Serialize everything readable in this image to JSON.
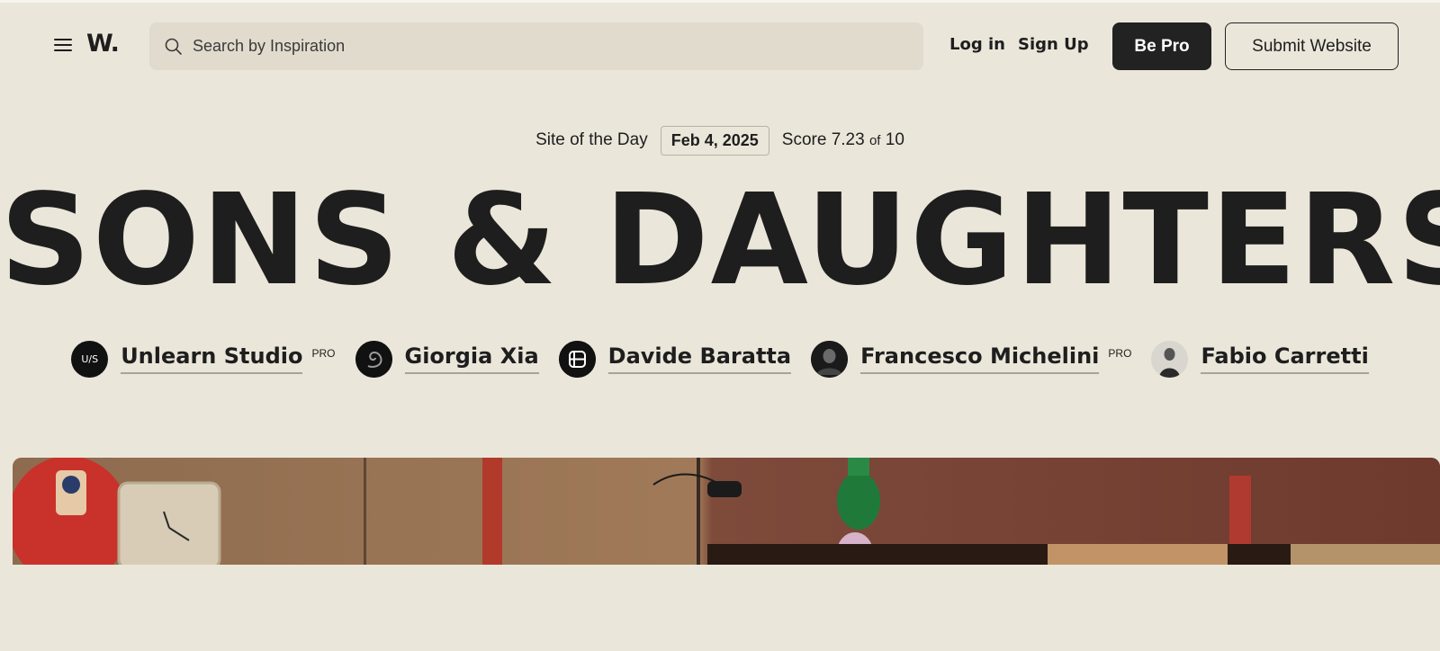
{
  "header": {
    "logo": "W.",
    "search_placeholder": "Search by Inspiration",
    "login_label": "Log in",
    "signup_label": "Sign Up",
    "be_pro_label": "Be Pro",
    "submit_label": "Submit Website"
  },
  "award": {
    "label": "Site of the Day",
    "date": "Feb 4, 2025",
    "score_prefix": "Score 7.23",
    "score_of": "of",
    "score_max": "10"
  },
  "site_title": "SONS & DAUGHTERS",
  "credits": [
    {
      "name": "Unlearn Studio",
      "pro": "PRO",
      "avatar": "U/S"
    },
    {
      "name": "Giorgia Xia",
      "pro": "",
      "avatar": ""
    },
    {
      "name": "Davide Baratta",
      "pro": "",
      "avatar": ""
    },
    {
      "name": "Francesco Michelini",
      "pro": "PRO",
      "avatar": ""
    },
    {
      "name": "Fabio Carretti",
      "pro": "",
      "avatar": ""
    }
  ],
  "colors": {
    "background": "#ebe6da",
    "search_bg": "#e1dbcd",
    "primary_button": "#222222",
    "text": "#1e1e1e"
  },
  "icons": {
    "menu": "hamburger-icon",
    "search": "search-icon"
  }
}
